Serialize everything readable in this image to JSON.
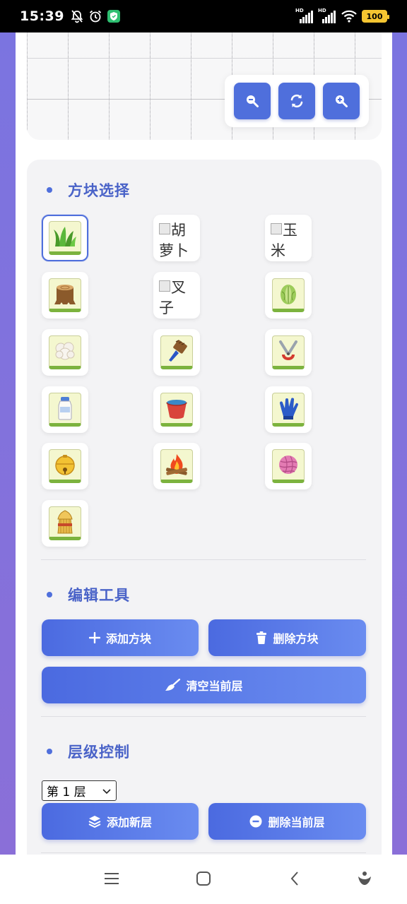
{
  "status_bar": {
    "time": "15:39",
    "icons": [
      "mute-bell-icon",
      "alarm-icon",
      "shield-app-icon",
      "hd-signal-icon",
      "hd-signal-icon",
      "wifi-icon",
      "battery-icon"
    ],
    "hd_label": "HD",
    "battery": "100"
  },
  "zoom_controls": {
    "icons": [
      "zoom-out-icon",
      "refresh-icon",
      "zoom-in-icon"
    ]
  },
  "block_section": {
    "title": "方块选择",
    "tiles": [
      {
        "icon": "grass-icon",
        "selected": true
      },
      {
        "broken_alt": "胡萝卜"
      },
      {
        "broken_alt": "玉米"
      },
      {
        "icon": "tree-stump-icon"
      },
      {
        "broken_alt": "叉子"
      },
      {
        "icon": "cabbage-icon"
      },
      {
        "icon": "cotton-icon"
      },
      {
        "icon": "brush-icon"
      },
      {
        "icon": "shears-icon"
      },
      {
        "icon": "milk-bottle-icon"
      },
      {
        "icon": "bucket-icon"
      },
      {
        "icon": "glove-icon"
      },
      {
        "icon": "bell-icon"
      },
      {
        "icon": "campfire-icon"
      },
      {
        "icon": "yarn-ball-icon"
      },
      {
        "icon": "wheat-bundle-icon"
      }
    ]
  },
  "edit_section": {
    "title": "编辑工具",
    "add_block": "添加方块",
    "delete_block": "删除方块",
    "clear_layer": "清空当前层"
  },
  "layer_section": {
    "title": "层级控制",
    "selected_layer": "第 1 层",
    "add_layer": "添加新层",
    "delete_layer": "删除当前层"
  },
  "nav_bar": {
    "icons": [
      "menu-icon",
      "home-icon",
      "back-icon",
      "assistant-icon"
    ]
  },
  "colors": {
    "accent": "#4f6fdc",
    "title": "#4a63c8",
    "side_gradient": "#7b74e0"
  }
}
